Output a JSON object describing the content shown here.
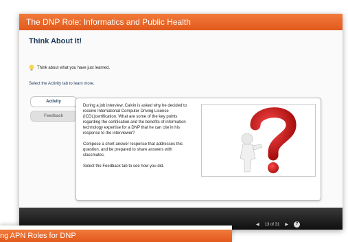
{
  "window": {
    "title": "The DNP Role: Informatics and Public Health",
    "heading": "Think About It!",
    "think_text": "Think about what you have just learned.",
    "select_text": "Select the Activity tab to learn more.",
    "tabs": [
      {
        "label": "Activity",
        "selected": true
      },
      {
        "label": "Feedback",
        "selected": false
      }
    ],
    "activity": {
      "paragraphs": [
        "During a job interview, Calvin is asked why he decided to receive International Computer Driving License (ICDL)certification. What are some of the key points regarding the certification and the benefits of information technology expertise for a DNP that he can cite in his response to the interviewer?",
        "Compose a short answer response that addresses this question, and be prepared to share answers with classmates.",
        "Select the Feedback tab to see how you did."
      ]
    },
    "illustration_icon": "question-mark-figure-icon",
    "controls": {
      "page_indicator": "13 of 31"
    }
  },
  "second_window": {
    "title": "ng APN Roles for DNP"
  },
  "colors": {
    "titlebar": "#e8641f",
    "heading": "#1d3a5a",
    "question_mark": "#d42020"
  }
}
